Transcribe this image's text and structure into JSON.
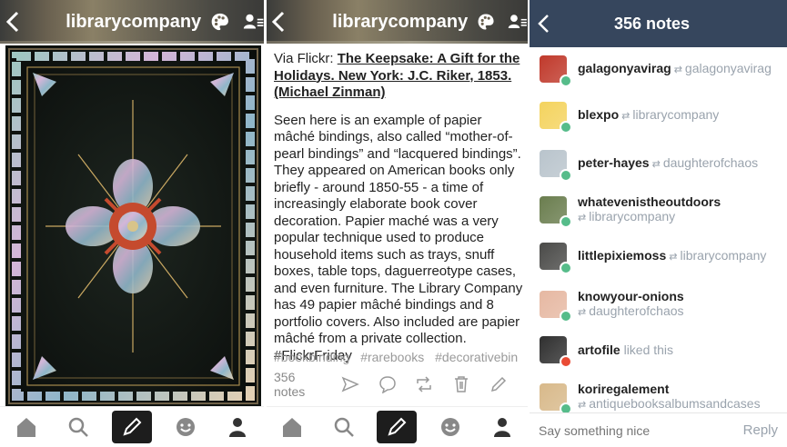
{
  "panel1": {
    "header": {
      "title": "librarycompany"
    }
  },
  "panel2": {
    "header": {
      "title": "librarycompany"
    },
    "post": {
      "via": "Via Flickr: ",
      "link": "The Keepsake: A Gift for the Holidays. New York: J.C. Riker, 1853. (Michael Zinman)",
      "body": "Seen here is an example of papier mâché bindings, also called “mother-of-pearl bindings” and “lacquered bindings”. They appeared on American books only briefly - around 1850-55 - a time of increasingly elaborate book cover decoration. Papier maché was a very popular technique used to produce household items such as trays, snuff boxes, table tops, daguerreotype cases, and even furniture. The Library Company has 49 papier mâché bindings and 8 portfolio covers. Also included are papier mâché from a private collection. #FlickrFriday",
      "tags": [
        "#bookbinding",
        "#rarebooks",
        "#decorativebin"
      ],
      "notes_count": "356 notes"
    }
  },
  "panel3": {
    "header": {
      "title": "356 notes"
    },
    "notes": [
      {
        "user": "galagonyavirag",
        "source": "galagonyavirag",
        "type": "reblog",
        "two_line": false,
        "color": "#c0392b"
      },
      {
        "user": "blexpo",
        "source": "librarycompany",
        "type": "reblog",
        "two_line": false,
        "color": "#f4d35e"
      },
      {
        "user": "peter-hayes",
        "source": "daughterofchaos",
        "type": "reblog",
        "two_line": false,
        "color": "#b9c4cc"
      },
      {
        "user": "whatevenistheoutdoors",
        "source": "librarycompany",
        "type": "reblog",
        "two_line": true,
        "color": "#6a7d4e"
      },
      {
        "user": "littlepixiemoss",
        "source": "librarycompany",
        "type": "reblog",
        "two_line": false,
        "color": "#4a4a48"
      },
      {
        "user": "knowyour-onions",
        "source": "daughterofchaos",
        "type": "reblog",
        "two_line": true,
        "color": "#e6b8a2"
      },
      {
        "user": "artofile",
        "source": "liked this",
        "type": "like",
        "two_line": false,
        "color": "#2f2f2f"
      },
      {
        "user": "koriregalement",
        "source": "antiquebooksalbumsandcases",
        "type": "reblog",
        "two_line": true,
        "color": "#d8b98a"
      }
    ],
    "reply": {
      "placeholder": "Say something nice",
      "button": "Reply"
    }
  },
  "colors": {
    "notes_header": "#36465d",
    "reblog_badge": "#56bc8a",
    "like_badge": "#e94b35"
  }
}
